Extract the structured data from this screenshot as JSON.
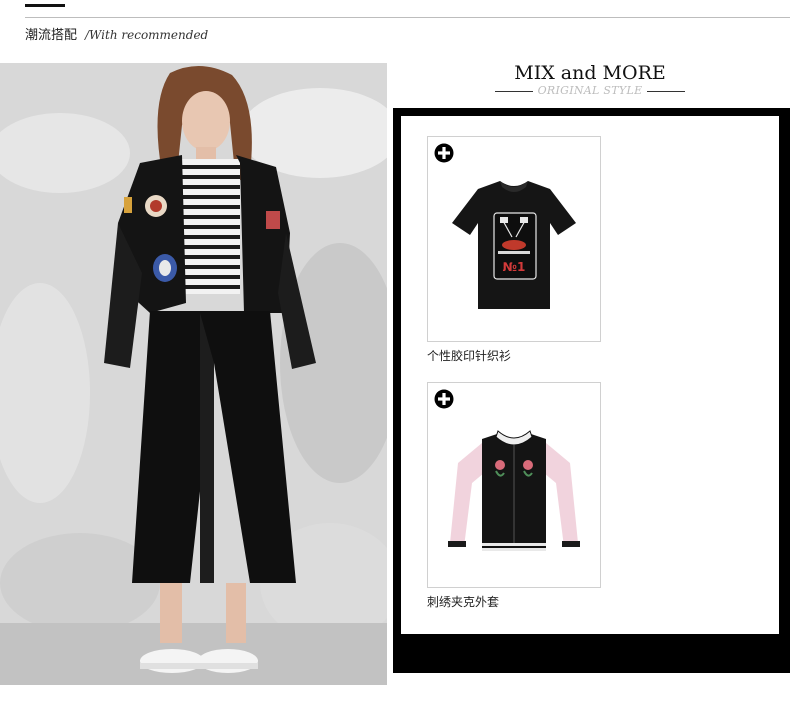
{
  "header": {
    "title_cn": "潮流搭配",
    "title_en": "/With recommended"
  },
  "mix": {
    "title": "MIX and MORE",
    "subtitle": "ORIGINAL STYLE"
  },
  "products": [
    {
      "name": "个性胶印针织衫",
      "icon": "plus-icon"
    },
    {
      "name": "刺绣夹克外套",
      "icon": "plus-icon"
    }
  ],
  "colors": {
    "panel_border": "#000000",
    "accent_rule": "#111111",
    "subtitle_gray": "#bdbdbd"
  }
}
